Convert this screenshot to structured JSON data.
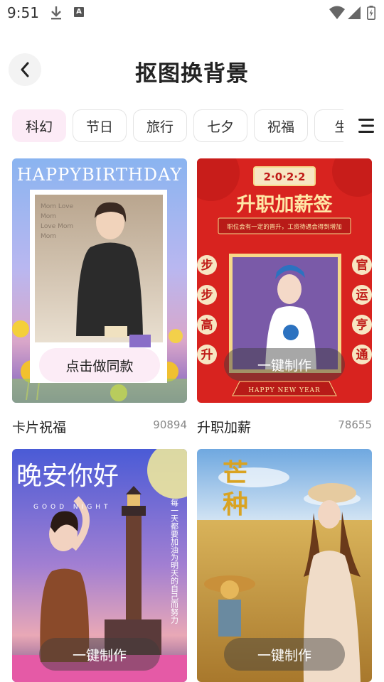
{
  "status_bar": {
    "time": "9:51"
  },
  "header": {
    "title": "抠图换背景"
  },
  "tabs": [
    {
      "label": "科幻",
      "active": true
    },
    {
      "label": "节日",
      "active": false
    },
    {
      "label": "旅行",
      "active": false
    },
    {
      "label": "七夕",
      "active": false
    },
    {
      "label": "祝福",
      "active": false
    },
    {
      "label": "生",
      "active": false
    }
  ],
  "cards": [
    {
      "name": "卡片祝福",
      "count": "90894",
      "cta": "点击做同款",
      "banner": "HAPPYBIRTHDAY"
    },
    {
      "name": "升职加薪",
      "count": "78655",
      "cta": "一键制作",
      "year": "2·0·2·2",
      "headline": "升职加薪签",
      "subline": "职位会有一定的晋升，工资待遇会得到增加",
      "left_chars": [
        "步",
        "步",
        "高",
        "升"
      ],
      "right_chars": [
        "官",
        "运",
        "亨",
        "通"
      ],
      "footer": "HAPPY NEW YEAR"
    },
    {
      "cta": "一键制作",
      "headline": "晚安你好",
      "tagline": "GOOD NIGHT",
      "side_text": "每一天都要加油为明天的自己而努力"
    },
    {
      "cta": "一键制作",
      "headline_1": "芒",
      "headline_2": "种"
    }
  ],
  "colors": {
    "accent_pink": "#fcebf6",
    "festive_red": "#d8231f",
    "gold": "#f6d98a"
  }
}
